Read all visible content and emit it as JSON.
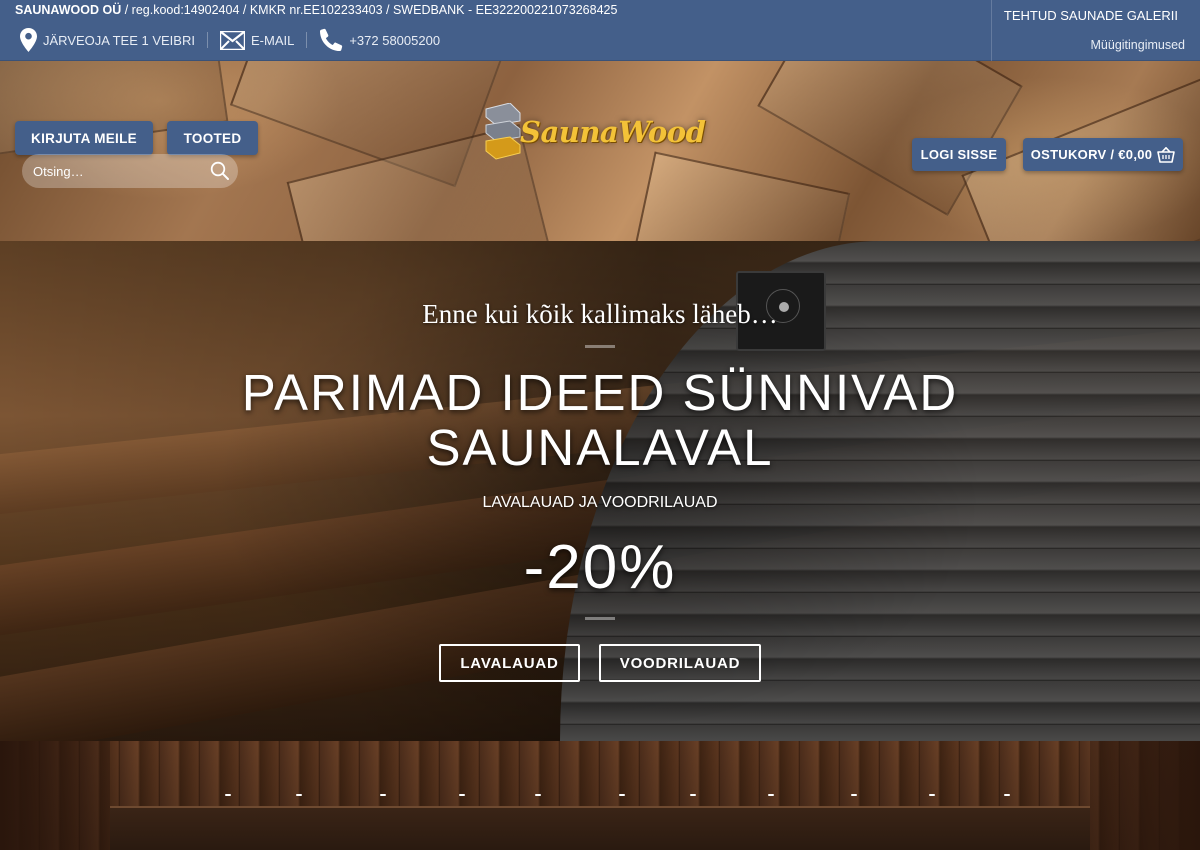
{
  "topbar": {
    "company_name": "SAUNAWOOD OÜ",
    "company_details": " / reg.kood:14902404 / KMKR nr.EE102233403 / SWEDBANK - EE322200221073268425",
    "address": "JÄRVEOJA TEE 1 VEIBRI",
    "email_label": "E-MAIL",
    "phone": "+372 58005200",
    "gallery_link": "TEHTUD SAUNADE GALERII",
    "terms_link": "Müügitingimused"
  },
  "header": {
    "write_us_button": "KIRJUTA MEILE",
    "products_button": "TOOTED",
    "search_placeholder": "Otsing…",
    "logo_text": "SaunaWood",
    "login_button": "LOGI SISSE",
    "cart_button": "OSTUKORV / €0,00"
  },
  "hero": {
    "subtitle": "Enne kui kõik kallimaks läheb…",
    "headline_line1": "PARIMAD IDEED SÜNNIVAD",
    "headline_line2": "SAUNALAVAL",
    "products_line": "LAVALAUAD JA VOODRILAUAD",
    "discount": "-20%",
    "button_bench_boards": "LAVALAUAD",
    "button_lining_boards": "VOODRILAUAD"
  },
  "colors": {
    "brand_blue": "#445f8a",
    "logo_gold": "#f3c238"
  },
  "icons": {
    "address": "map-pin-icon",
    "email": "envelope-icon",
    "phone": "phone-icon",
    "search": "search-icon",
    "cart": "basket-icon"
  }
}
